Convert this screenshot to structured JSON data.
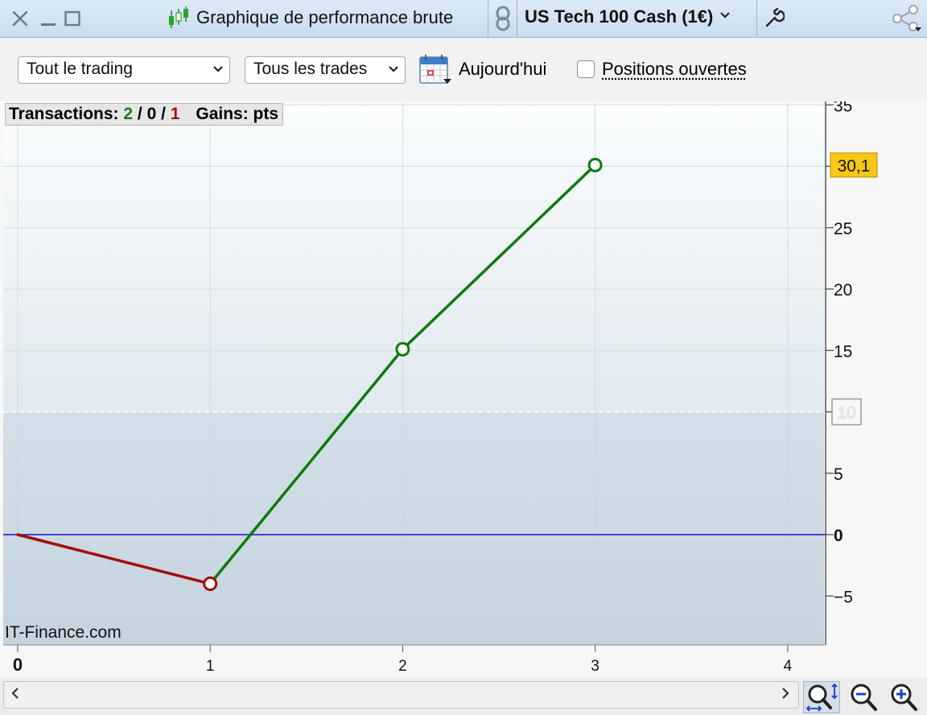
{
  "titlebar": {
    "title": "Graphique de performance brute",
    "instrument": "US Tech 100 Cash (1€)",
    "icons": [
      "close-icon",
      "minimize-icon",
      "maximize-icon",
      "candlestick-icon",
      "link-icon",
      "chevron-down-icon",
      "wrench-icon",
      "share-icon"
    ]
  },
  "toolbar": {
    "trading_select": "Tout le trading",
    "trades_select": "Tous les trades",
    "today_label": "Aujourd'hui",
    "open_positions_label": "Positions ouvertes",
    "open_positions_checked": false
  },
  "stats": {
    "transactions_label": "Transactions:",
    "wins": "2",
    "neutral": "0",
    "losses": "1",
    "separator": "/",
    "gains_label": "Gains: pts",
    "win_color": "#1a7a1a",
    "loss_color": "#a01010"
  },
  "watermark": "IT-Finance.com",
  "colors": {
    "win_line": "#0e7a0e",
    "loss_line": "#a00f0f",
    "zero_line": "#1414c8",
    "price_badge": "#f6c716"
  },
  "chart_data": {
    "type": "line",
    "x": [
      0,
      1,
      2,
      3
    ],
    "y": [
      0,
      -4,
      15.1,
      30.1
    ],
    "xlim": [
      0,
      4.2
    ],
    "ylim": [
      -9,
      35.5
    ],
    "x_ticks": [
      "0",
      "1",
      "2",
      "3",
      "4"
    ],
    "y_ticks": [
      "35",
      "30",
      "25",
      "20",
      "15",
      "10",
      "5",
      "0",
      "−5"
    ],
    "y_tick_values": [
      35,
      30,
      25,
      20,
      15,
      10,
      5,
      0,
      -5
    ],
    "last_value_label": "30,1",
    "last_value": 30.1,
    "dashed_level": 10,
    "dashed_level_label": "10",
    "zero_line": 0,
    "grid": true
  }
}
